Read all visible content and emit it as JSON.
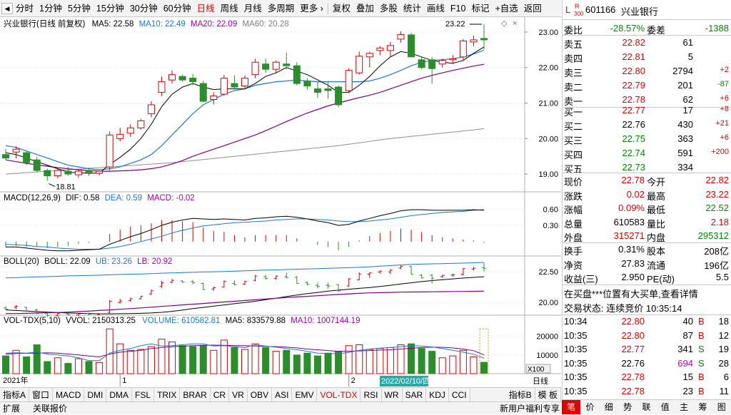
{
  "toolbar": {
    "items": [
      "分时",
      "1分钟",
      "5分钟",
      "15分钟",
      "30分钟",
      "60分钟",
      "日线",
      "周线",
      "月线",
      "多周期",
      "更多 ›"
    ],
    "active": "日线",
    "items2": [
      "复权",
      "叠加",
      "多股",
      "统计",
      "画线",
      "F10",
      "标记",
      "+自选",
      "返回"
    ]
  },
  "main": {
    "title": "兴业银行(日线 前复权)",
    "ma5": "MA5: 22.58",
    "ma10": "MA10: 22.49",
    "ma20": "MA20: 22.09",
    "ma60": "MA60: 20.28",
    "high_label": "23.22",
    "low_label": "18.81",
    "yticks": [
      "23.00",
      "22.00",
      "21.00",
      "20.00",
      "19.00"
    ]
  },
  "macd": {
    "title": "MACD(12,26,9)",
    "dif": "DIF: 0.58",
    "dea": "DEA: 0.59",
    "macd": "MACD: -0.02",
    "yticks": [
      "0.60",
      "0.30"
    ]
  },
  "boll": {
    "title": "BOLL(20)",
    "boll": "BOLL: 22.09",
    "ub": "UB: 23.26",
    "lb": "LB: 20.92",
    "yticks": [
      "22.50",
      "20.00"
    ]
  },
  "vol": {
    "title": "VOL-TDX(5,10)",
    "vvol": "VVOL: 2150313.25",
    "volume": "VOLUME: 610582.81",
    "ma5": "MA5: 833579.88",
    "ma10": "MA10: 1007144.19",
    "yticks": [
      "20000",
      "10000"
    ],
    "unit": "X100"
  },
  "time_axis": {
    "year": "2021年",
    "m1": "1",
    "m2": "2",
    "cursor_date": "2022/02/10/四",
    "period": "日线"
  },
  "bottom_tabs": [
    "指标A",
    "窗口",
    "MACD",
    "DMI",
    "DMA",
    "FSL",
    "TRIX",
    "BRAR",
    "CR",
    "VR",
    "OBV",
    "ASI",
    "EMV",
    "VOL-TDX",
    "RSI",
    "WR",
    "SAR",
    "KDJ",
    "CCI"
  ],
  "bottom_active": "VOL-TDX",
  "bottom_right": [
    "指标B",
    "模 板"
  ],
  "status": {
    "left1": "扩展",
    "left2": "关联报价",
    "right": "新用户福利专享"
  },
  "quote": {
    "code": "601166",
    "name": "兴业银行",
    "badge_l": "L",
    "badge_r": "R",
    "badge_n": "300",
    "wb_label": "委比",
    "wb_val": "-28.57%",
    "wc_label": "委差",
    "wc_val": "-1388",
    "sell": [
      {
        "label": "卖五",
        "price": "22.82",
        "vol": "61",
        "chg": ""
      },
      {
        "label": "卖四",
        "price": "22.81",
        "vol": "5",
        "chg": ""
      },
      {
        "label": "卖三",
        "price": "22.80",
        "vol": "2794",
        "chg": "+2"
      },
      {
        "label": "卖二",
        "price": "22.79",
        "vol": "201",
        "chg": "-87"
      },
      {
        "label": "卖一",
        "price": "22.78",
        "vol": "62",
        "chg": "+6"
      }
    ],
    "buy": [
      {
        "label": "买一",
        "price": "22.77",
        "vol": "17",
        "chg": "+8"
      },
      {
        "label": "买二",
        "price": "22.76",
        "vol": "430",
        "chg": "+21"
      },
      {
        "label": "买三",
        "price": "22.75",
        "vol": "363",
        "chg": "+6"
      },
      {
        "label": "买四",
        "price": "22.74",
        "vol": "591",
        "chg": "+200"
      },
      {
        "label": "买五",
        "price": "22.73",
        "vol": "334",
        "chg": ""
      }
    ],
    "stats": [
      [
        "现价",
        "22.78",
        "今开",
        "22.82"
      ],
      [
        "涨跌",
        "0.02",
        "最高",
        "23.22"
      ],
      [
        "涨幅",
        "0.09%",
        "最低",
        "22.52"
      ],
      [
        "总量",
        "610583",
        "量比",
        "2.18"
      ],
      [
        "外盘",
        "315271",
        "内盘",
        "295312"
      ]
    ],
    "stats2": [
      [
        "换手",
        "0.31%",
        "股本",
        "208亿"
      ],
      [
        "净资",
        "27.83",
        "流通",
        "196亿"
      ],
      [
        "收益(三)",
        "2.950",
        "PE(动)",
        "5.5"
      ]
    ],
    "notice": "在买盘***位置有大买单,查看详情",
    "trade_status": "交易状态: 连续竞价 10:35:14",
    "ticks": [
      [
        "10:34",
        "22.80",
        "40",
        "B",
        "18"
      ],
      [
        "10:35",
        "22.80",
        "87",
        "B",
        "12"
      ],
      [
        "10:35",
        "22.77",
        "341",
        "S",
        "19"
      ],
      [
        "10:35",
        "22.76",
        "694",
        "S",
        "28"
      ],
      [
        "10:35",
        "22.78",
        "15",
        "B",
        "6"
      ],
      [
        "10:35",
        "22.78",
        "23",
        "B",
        "11"
      ]
    ],
    "tabs": [
      "笔",
      "价",
      "细",
      "势",
      "联",
      "值",
      "主",
      "筹",
      "图"
    ],
    "active_tab": "笔"
  },
  "chart_data": {
    "type": "candlestick",
    "candles": [
      [
        19.55,
        19.7,
        19.4,
        19.45
      ],
      [
        19.62,
        19.78,
        19.45,
        19.7
      ],
      [
        19.6,
        19.65,
        19.25,
        19.32
      ],
      [
        19.4,
        19.48,
        19.05,
        19.1
      ],
      [
        19.1,
        19.15,
        18.81,
        18.95
      ],
      [
        18.95,
        19.15,
        18.88,
        19.1
      ],
      [
        19.08,
        19.2,
        18.95,
        19.0
      ],
      [
        18.98,
        19.12,
        18.9,
        19.08
      ],
      [
        19.1,
        19.18,
        18.95,
        19.05
      ],
      [
        19.02,
        19.1,
        18.96,
        19.08
      ],
      [
        19.2,
        20.2,
        19.1,
        20.1
      ],
      [
        20.0,
        20.3,
        19.92,
        20.12
      ],
      [
        20.15,
        20.4,
        20.05,
        20.3
      ],
      [
        20.3,
        20.55,
        20.25,
        20.5
      ],
      [
        20.7,
        21.05,
        20.6,
        20.95
      ],
      [
        21.3,
        21.75,
        21.2,
        21.6
      ],
      [
        21.65,
        21.92,
        21.55,
        21.8
      ],
      [
        21.75,
        21.8,
        21.6,
        21.65
      ],
      [
        21.7,
        21.82,
        21.5,
        21.6
      ],
      [
        21.55,
        21.62,
        21.02,
        21.05
      ],
      [
        21.1,
        21.3,
        20.96,
        21.2
      ],
      [
        21.25,
        21.8,
        21.2,
        21.7
      ],
      [
        21.55,
        21.78,
        21.38,
        21.45
      ],
      [
        21.48,
        21.78,
        21.42,
        21.7
      ],
      [
        21.8,
        22.25,
        21.7,
        22.15
      ],
      [
        22.1,
        22.25,
        21.85,
        21.95
      ],
      [
        21.95,
        22.2,
        21.85,
        22.15
      ],
      [
        22.1,
        22.42,
        21.95,
        22.05
      ],
      [
        22.05,
        22.15,
        21.5,
        21.55
      ],
      [
        21.62,
        21.7,
        21.38,
        21.48
      ],
      [
        21.4,
        21.6,
        21.15,
        21.3
      ],
      [
        21.4,
        21.6,
        21.12,
        21.35
      ],
      [
        21.45,
        21.5,
        20.88,
        20.95
      ],
      [
        21.35,
        21.98,
        21.28,
        21.92
      ],
      [
        21.85,
        22.45,
        21.8,
        22.32
      ],
      [
        22.3,
        22.45,
        22.0,
        22.4
      ],
      [
        22.48,
        22.6,
        22.35,
        22.55
      ],
      [
        22.48,
        22.72,
        22.3,
        22.62
      ],
      [
        22.8,
        23.02,
        22.7,
        22.93
      ],
      [
        22.92,
        22.98,
        22.3,
        22.3
      ],
      [
        22.22,
        22.3,
        21.95,
        22.0
      ],
      [
        22.22,
        22.3,
        21.55,
        21.97
      ],
      [
        22.1,
        22.25,
        22.0,
        22.2
      ],
      [
        22.22,
        22.35,
        22.1,
        22.25
      ],
      [
        22.3,
        22.8,
        22.2,
        22.75
      ],
      [
        22.72,
        22.9,
        22.6,
        22.78
      ],
      [
        22.82,
        23.22,
        22.52,
        22.78
      ]
    ],
    "ylim": [
      18.6,
      23.3
    ],
    "ma5": [
      19.6,
      19.55,
      19.45,
      19.35,
      19.25,
      19.15,
      19.05,
      19.04,
      19.02,
      19.03,
      19.27,
      19.47,
      19.7,
      20.0,
      20.4,
      20.9,
      21.25,
      21.45,
      21.55,
      21.45,
      21.38,
      21.4,
      21.4,
      21.4,
      21.55,
      21.75,
      21.85,
      22.0,
      21.9,
      21.8,
      21.65,
      21.5,
      21.3,
      21.3,
      21.5,
      21.75,
      22.05,
      22.3,
      22.45,
      22.4,
      22.3,
      22.2,
      22.15,
      22.12,
      22.2,
      22.4,
      22.58
    ],
    "ma10": [
      19.8,
      19.75,
      19.65,
      19.55,
      19.45,
      19.35,
      19.25,
      19.2,
      19.15,
      19.12,
      19.15,
      19.2,
      19.3,
      19.4,
      19.55,
      19.8,
      20.1,
      20.4,
      20.7,
      20.95,
      21.1,
      21.25,
      21.35,
      21.4,
      21.5,
      21.55,
      21.6,
      21.62,
      21.65,
      21.62,
      21.6,
      21.6,
      21.6,
      21.6,
      21.6,
      21.62,
      21.7,
      21.8,
      21.92,
      22.05,
      22.15,
      22.2,
      22.22,
      22.25,
      22.3,
      22.38,
      22.49
    ],
    "ma20": [
      19.4,
      19.35,
      19.3,
      19.26,
      19.22,
      19.18,
      19.15,
      19.12,
      19.1,
      19.08,
      19.08,
      19.09,
      19.1,
      19.12,
      19.15,
      19.2,
      19.28,
      19.38,
      19.5,
      19.6,
      19.7,
      19.8,
      19.9,
      20.0,
      20.1,
      20.22,
      20.35,
      20.48,
      20.6,
      20.72,
      20.82,
      20.92,
      21.0,
      21.08,
      21.15,
      21.22,
      21.3,
      21.4,
      21.5,
      21.6,
      21.7,
      21.78,
      21.85,
      21.92,
      21.98,
      22.04,
      22.09
    ],
    "ma60": [
      19.0,
      19.02,
      19.04,
      19.06,
      19.08,
      19.1,
      19.12,
      19.14,
      19.16,
      19.18,
      19.2,
      19.22,
      19.24,
      19.26,
      19.28,
      19.3,
      19.32,
      19.35,
      19.38,
      19.41,
      19.44,
      19.47,
      19.5,
      19.53,
      19.56,
      19.59,
      19.62,
      19.65,
      19.68,
      19.71,
      19.74,
      19.77,
      19.8,
      19.84,
      19.88,
      19.92,
      19.96,
      20.0,
      20.03,
      20.06,
      20.09,
      20.12,
      20.15,
      20.18,
      20.21,
      20.24,
      20.28
    ],
    "macd_dif": [
      -0.1,
      -0.1,
      -0.12,
      -0.14,
      -0.16,
      -0.17,
      -0.17,
      -0.16,
      -0.15,
      -0.14,
      -0.05,
      0.02,
      0.09,
      0.15,
      0.22,
      0.3,
      0.36,
      0.4,
      0.43,
      0.42,
      0.41,
      0.42,
      0.41,
      0.4,
      0.43,
      0.44,
      0.46,
      0.47,
      0.45,
      0.42,
      0.38,
      0.35,
      0.3,
      0.32,
      0.38,
      0.43,
      0.48,
      0.52,
      0.57,
      0.59,
      0.59,
      0.58,
      0.58,
      0.58,
      0.58,
      0.59,
      0.58
    ],
    "macd_dea": [
      -0.05,
      -0.06,
      -0.07,
      -0.09,
      -0.1,
      -0.12,
      -0.13,
      -0.14,
      -0.14,
      -0.14,
      -0.12,
      -0.09,
      -0.05,
      0.0,
      0.05,
      0.1,
      0.16,
      0.21,
      0.25,
      0.29,
      0.31,
      0.33,
      0.35,
      0.36,
      0.37,
      0.38,
      0.4,
      0.41,
      0.42,
      0.42,
      0.41,
      0.4,
      0.38,
      0.37,
      0.37,
      0.38,
      0.4,
      0.42,
      0.45,
      0.48,
      0.5,
      0.52,
      0.54,
      0.55,
      0.56,
      0.58,
      0.59
    ],
    "volume": [
      9500,
      12500,
      9000,
      15500,
      6500,
      8500,
      5500,
      8000,
      6500,
      6000,
      24000,
      16000,
      12500,
      13000,
      14500,
      18500,
      17000,
      15000,
      14500,
      15000,
      12500,
      18000,
      14000,
      13000,
      16000,
      14000,
      12000,
      12500,
      10000,
      11000,
      9500,
      11000,
      12000,
      15000,
      15500,
      13000,
      13500,
      14000,
      15500,
      16000,
      13500,
      12000,
      8500,
      9500,
      12500,
      9000,
      6106
    ],
    "vol_ma5": [
      11000,
      11200,
      11000,
      11500,
      10500,
      10000,
      9500,
      8500,
      7000,
      7000,
      11000,
      12500,
      13500,
      15000,
      16000,
      14800,
      15000,
      15500,
      16000,
      16000,
      14800,
      15000,
      14500,
      14000,
      15500,
      14800,
      14200,
      13500,
      12800,
      12000,
      11000,
      10800,
      10700,
      11400,
      12500,
      13200,
      13700,
      14000,
      14500,
      15000,
      14800,
      14300,
      13500,
      12500,
      11500,
      10400,
      8336
    ],
    "vol_ma10": [
      10500,
      10800,
      10900,
      11000,
      11200,
      11000,
      10500,
      10000,
      9500,
      9000,
      10500,
      11500,
      12000,
      12500,
      13500,
      14000,
      14500,
      14700,
      15000,
      15200,
      15300,
      15200,
      15000,
      15000,
      14800,
      14600,
      14500,
      14200,
      13800,
      13200,
      12800,
      12400,
      12000,
      12000,
      12200,
      12400,
      12600,
      12800,
      13200,
      13600,
      14000,
      14200,
      14100,
      13800,
      13200,
      12300,
      10071
    ],
    "boll_ub": [
      22.0,
      22.02,
      22.05,
      22.08,
      22.1,
      22.13,
      22.16,
      22.18,
      22.2,
      22.22,
      22.25,
      22.28,
      22.3,
      22.32,
      22.35,
      22.38,
      22.4,
      22.43,
      22.45,
      22.48,
      22.5,
      22.52,
      22.55,
      22.58,
      22.6,
      22.63,
      22.65,
      22.68,
      22.7,
      22.73,
      22.75,
      22.78,
      22.8,
      22.83,
      22.86,
      22.9,
      22.95,
      23.0,
      23.05,
      23.1,
      23.12,
      23.14,
      23.16,
      23.18,
      23.2,
      23.23,
      23.26
    ],
    "boll_lb": [
      19.1,
      19.1,
      19.12,
      19.14,
      19.16,
      19.18,
      19.22,
      19.26,
      19.3,
      19.35,
      19.4,
      19.45,
      19.5,
      19.56,
      19.62,
      19.68,
      19.74,
      19.8,
      19.86,
      19.92,
      19.98,
      20.04,
      20.1,
      20.16,
      20.22,
      20.28,
      20.34,
      20.4,
      20.45,
      20.5,
      20.55,
      20.6,
      20.65,
      20.7,
      20.74,
      20.78,
      20.8,
      20.82,
      20.84,
      20.85,
      20.86,
      20.87,
      20.88,
      20.89,
      20.9,
      20.91,
      20.92
    ]
  }
}
